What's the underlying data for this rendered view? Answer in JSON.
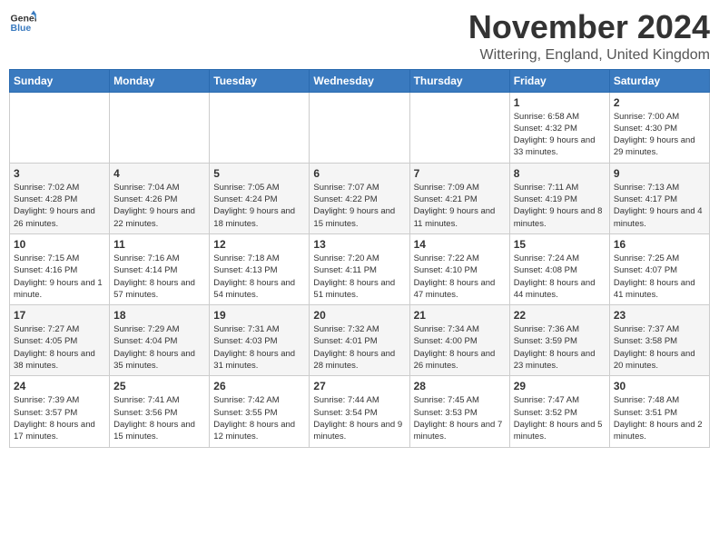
{
  "header": {
    "logo_general": "General",
    "logo_blue": "Blue",
    "month_title": "November 2024",
    "location": "Wittering, England, United Kingdom"
  },
  "days_of_week": [
    "Sunday",
    "Monday",
    "Tuesday",
    "Wednesday",
    "Thursday",
    "Friday",
    "Saturday"
  ],
  "weeks": [
    [
      {
        "day": "",
        "sunrise": "",
        "sunset": "",
        "daylight": ""
      },
      {
        "day": "",
        "sunrise": "",
        "sunset": "",
        "daylight": ""
      },
      {
        "day": "",
        "sunrise": "",
        "sunset": "",
        "daylight": ""
      },
      {
        "day": "",
        "sunrise": "",
        "sunset": "",
        "daylight": ""
      },
      {
        "day": "",
        "sunrise": "",
        "sunset": "",
        "daylight": ""
      },
      {
        "day": "1",
        "sunrise": "Sunrise: 6:58 AM",
        "sunset": "Sunset: 4:32 PM",
        "daylight": "Daylight: 9 hours and 33 minutes."
      },
      {
        "day": "2",
        "sunrise": "Sunrise: 7:00 AM",
        "sunset": "Sunset: 4:30 PM",
        "daylight": "Daylight: 9 hours and 29 minutes."
      }
    ],
    [
      {
        "day": "3",
        "sunrise": "Sunrise: 7:02 AM",
        "sunset": "Sunset: 4:28 PM",
        "daylight": "Daylight: 9 hours and 26 minutes."
      },
      {
        "day": "4",
        "sunrise": "Sunrise: 7:04 AM",
        "sunset": "Sunset: 4:26 PM",
        "daylight": "Daylight: 9 hours and 22 minutes."
      },
      {
        "day": "5",
        "sunrise": "Sunrise: 7:05 AM",
        "sunset": "Sunset: 4:24 PM",
        "daylight": "Daylight: 9 hours and 18 minutes."
      },
      {
        "day": "6",
        "sunrise": "Sunrise: 7:07 AM",
        "sunset": "Sunset: 4:22 PM",
        "daylight": "Daylight: 9 hours and 15 minutes."
      },
      {
        "day": "7",
        "sunrise": "Sunrise: 7:09 AM",
        "sunset": "Sunset: 4:21 PM",
        "daylight": "Daylight: 9 hours and 11 minutes."
      },
      {
        "day": "8",
        "sunrise": "Sunrise: 7:11 AM",
        "sunset": "Sunset: 4:19 PM",
        "daylight": "Daylight: 9 hours and 8 minutes."
      },
      {
        "day": "9",
        "sunrise": "Sunrise: 7:13 AM",
        "sunset": "Sunset: 4:17 PM",
        "daylight": "Daylight: 9 hours and 4 minutes."
      }
    ],
    [
      {
        "day": "10",
        "sunrise": "Sunrise: 7:15 AM",
        "sunset": "Sunset: 4:16 PM",
        "daylight": "Daylight: 9 hours and 1 minute."
      },
      {
        "day": "11",
        "sunrise": "Sunrise: 7:16 AM",
        "sunset": "Sunset: 4:14 PM",
        "daylight": "Daylight: 8 hours and 57 minutes."
      },
      {
        "day": "12",
        "sunrise": "Sunrise: 7:18 AM",
        "sunset": "Sunset: 4:13 PM",
        "daylight": "Daylight: 8 hours and 54 minutes."
      },
      {
        "day": "13",
        "sunrise": "Sunrise: 7:20 AM",
        "sunset": "Sunset: 4:11 PM",
        "daylight": "Daylight: 8 hours and 51 minutes."
      },
      {
        "day": "14",
        "sunrise": "Sunrise: 7:22 AM",
        "sunset": "Sunset: 4:10 PM",
        "daylight": "Daylight: 8 hours and 47 minutes."
      },
      {
        "day": "15",
        "sunrise": "Sunrise: 7:24 AM",
        "sunset": "Sunset: 4:08 PM",
        "daylight": "Daylight: 8 hours and 44 minutes."
      },
      {
        "day": "16",
        "sunrise": "Sunrise: 7:25 AM",
        "sunset": "Sunset: 4:07 PM",
        "daylight": "Daylight: 8 hours and 41 minutes."
      }
    ],
    [
      {
        "day": "17",
        "sunrise": "Sunrise: 7:27 AM",
        "sunset": "Sunset: 4:05 PM",
        "daylight": "Daylight: 8 hours and 38 minutes."
      },
      {
        "day": "18",
        "sunrise": "Sunrise: 7:29 AM",
        "sunset": "Sunset: 4:04 PM",
        "daylight": "Daylight: 8 hours and 35 minutes."
      },
      {
        "day": "19",
        "sunrise": "Sunrise: 7:31 AM",
        "sunset": "Sunset: 4:03 PM",
        "daylight": "Daylight: 8 hours and 31 minutes."
      },
      {
        "day": "20",
        "sunrise": "Sunrise: 7:32 AM",
        "sunset": "Sunset: 4:01 PM",
        "daylight": "Daylight: 8 hours and 28 minutes."
      },
      {
        "day": "21",
        "sunrise": "Sunrise: 7:34 AM",
        "sunset": "Sunset: 4:00 PM",
        "daylight": "Daylight: 8 hours and 26 minutes."
      },
      {
        "day": "22",
        "sunrise": "Sunrise: 7:36 AM",
        "sunset": "Sunset: 3:59 PM",
        "daylight": "Daylight: 8 hours and 23 minutes."
      },
      {
        "day": "23",
        "sunrise": "Sunrise: 7:37 AM",
        "sunset": "Sunset: 3:58 PM",
        "daylight": "Daylight: 8 hours and 20 minutes."
      }
    ],
    [
      {
        "day": "24",
        "sunrise": "Sunrise: 7:39 AM",
        "sunset": "Sunset: 3:57 PM",
        "daylight": "Daylight: 8 hours and 17 minutes."
      },
      {
        "day": "25",
        "sunrise": "Sunrise: 7:41 AM",
        "sunset": "Sunset: 3:56 PM",
        "daylight": "Daylight: 8 hours and 15 minutes."
      },
      {
        "day": "26",
        "sunrise": "Sunrise: 7:42 AM",
        "sunset": "Sunset: 3:55 PM",
        "daylight": "Daylight: 8 hours and 12 minutes."
      },
      {
        "day": "27",
        "sunrise": "Sunrise: 7:44 AM",
        "sunset": "Sunset: 3:54 PM",
        "daylight": "Daylight: 8 hours and 9 minutes."
      },
      {
        "day": "28",
        "sunrise": "Sunrise: 7:45 AM",
        "sunset": "Sunset: 3:53 PM",
        "daylight": "Daylight: 8 hours and 7 minutes."
      },
      {
        "day": "29",
        "sunrise": "Sunrise: 7:47 AM",
        "sunset": "Sunset: 3:52 PM",
        "daylight": "Daylight: 8 hours and 5 minutes."
      },
      {
        "day": "30",
        "sunrise": "Sunrise: 7:48 AM",
        "sunset": "Sunset: 3:51 PM",
        "daylight": "Daylight: 8 hours and 2 minutes."
      }
    ]
  ]
}
